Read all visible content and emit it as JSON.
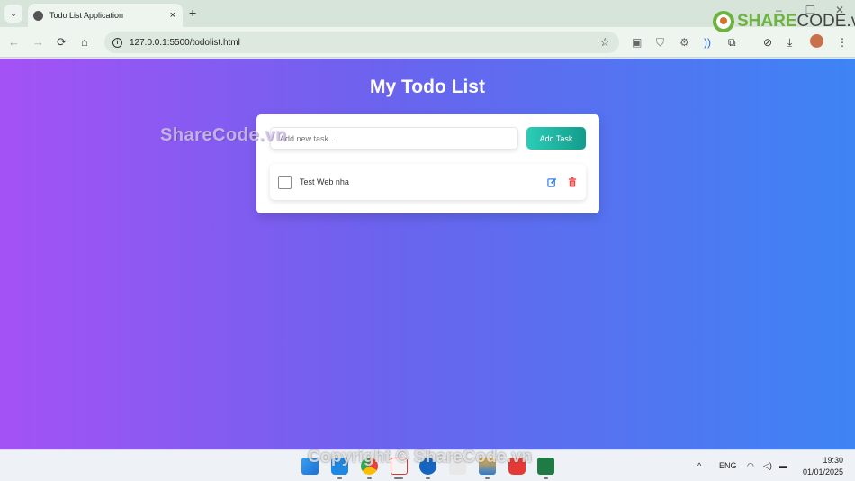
{
  "browser": {
    "tab_title": "Todo List Application",
    "tab_close": "×",
    "new_tab": "+",
    "tab_menu": "⌄",
    "url": "127.0.0.1:5500/todolist.html",
    "window_controls": {
      "minimize": "–",
      "maximize": "❐",
      "close": "✕"
    },
    "nav": {
      "back": "←",
      "forward": "→",
      "reload": "⟳",
      "home": "⌂"
    },
    "bookmark_star": "☆",
    "extensions": [
      "extension-stack-icon",
      "shield-icon",
      "settings-badge-icon",
      "read-aloud-icon",
      "puzzle-icon",
      "speedometer-icon",
      "download-icon",
      "profile-avatar",
      "menu-dots-icon"
    ]
  },
  "watermark": {
    "logo_green": "SHARE",
    "logo_dark": "CODE.vn",
    "middle": "ShareCode.vn",
    "bottom": "Copyright © ShareCode.vn"
  },
  "app": {
    "title": "My Todo List",
    "input": {
      "placeholder": "Add new task...",
      "value": ""
    },
    "add_button": "Add Task",
    "tasks": [
      {
        "text": "Test Web nha",
        "completed": false
      }
    ],
    "colors": {
      "gradient_start": "#a452f5",
      "gradient_end": "#3d84f5",
      "button_start": "#2bcdb7",
      "button_end": "#139c8c",
      "edit": "#3b82f6",
      "delete": "#ef4444"
    }
  },
  "taskbar": {
    "apps": [
      "windows-start",
      "vscode",
      "chrome",
      "snipping-tool",
      "zalo",
      "unknown-app",
      "file-explorer",
      "game-app",
      "excel"
    ],
    "tray": {
      "chevron": "^",
      "language": "ENG"
    },
    "time": "19:30",
    "date": "01/01/2025"
  }
}
